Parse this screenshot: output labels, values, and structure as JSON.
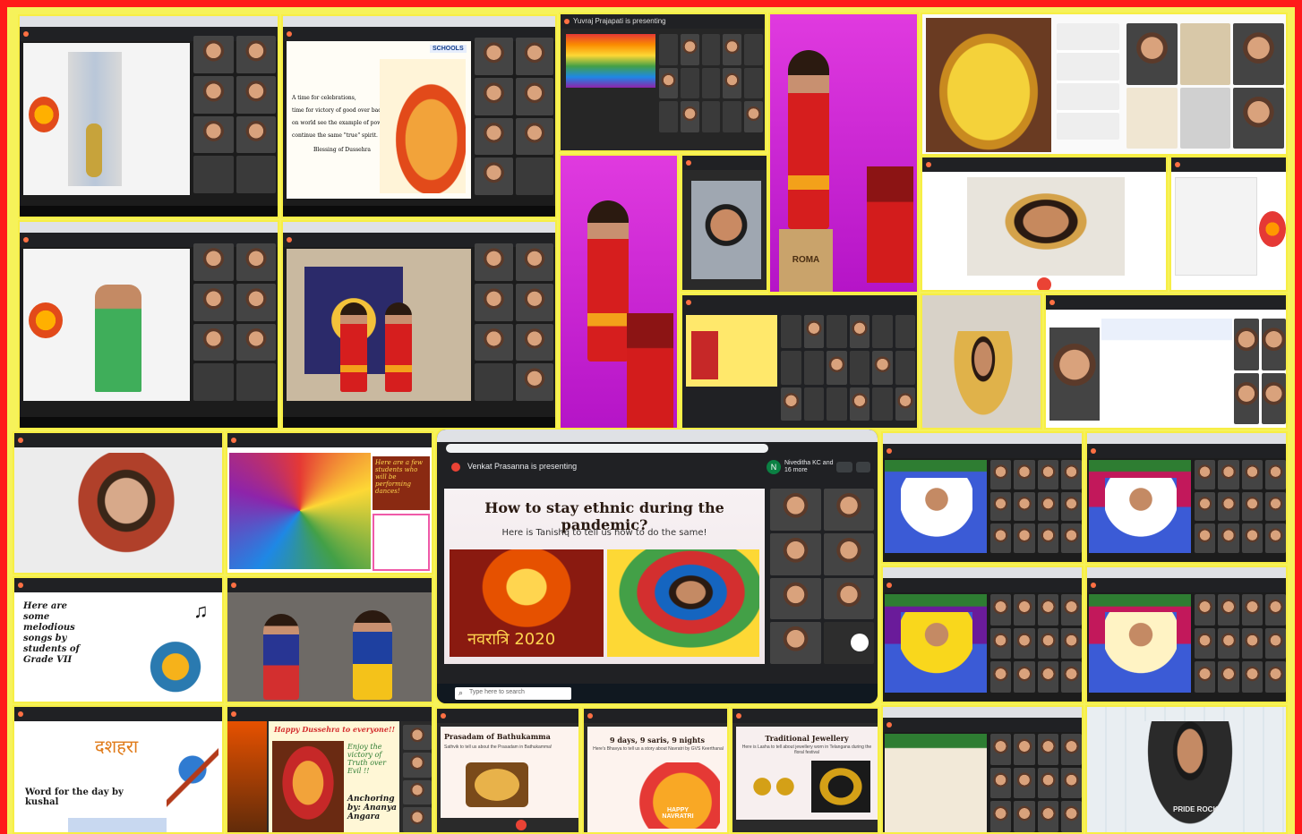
{
  "tiles": {
    "dussehra_card": {
      "lines": [
        "A time for celebrations,",
        "time for victory of good over bad,",
        "on world see the example of power of god",
        "continue the same \"true\" spirit.",
        "Blessing of Dussehra"
      ],
      "brand": "SCHOOLS"
    },
    "zoom_banner": {
      "text": "Yuvraj Prajapati is presenting"
    },
    "bathukamma_box": {
      "text": "ROMA"
    },
    "pandemic": {
      "presenter": "Venkat Prasanna is presenting",
      "participants": "Niveditha KC and 16 more",
      "avatar_letter": "N",
      "title": "How to stay ethnic during the pandemic?",
      "subtitle": "Here is Tanishq to tell us how to do the same!",
      "navratri_label": "नवरात्रि 2020",
      "search_placeholder": "Type here to search"
    },
    "dancers_note": {
      "text": "Here are a few students who will be performing dances!"
    },
    "songs": {
      "text": "Here are some melodious songs by students of Grade VII"
    },
    "word_of_day": {
      "title": "दशहरा",
      "caption": "Word for the day by kushal"
    },
    "happy_dussehra": {
      "title": "Happy Dussehra to everyone!!",
      "enjoy": "Enjoy the victory of Truth over Evil !!",
      "anchoring": "Anchoring by: Ananya Angara"
    },
    "prasadam": {
      "title": "Prasadam of Bathukamma",
      "subtitle": "Sathvik to tell us about the Prasadam in Bathukamma!"
    },
    "saris": {
      "title": "9 days, 9 saris, 9 nights",
      "subtitle": "Here's Bhavya to tell us a story about Navratri by GVS Keerthanal",
      "banner": "HAPPY NAVRATRI"
    },
    "jewellery": {
      "title": "Traditional Jewellery",
      "subtitle": "Here is Lasha to tell about jewellery worn in Telangana during the floral festival"
    },
    "kid_shirt": {
      "text": "PRIDE ROCK"
    }
  },
  "colors": {
    "frame": "#ff1a1a",
    "border": "#f7ee45",
    "meet_dark": "#202124",
    "record": "#ea4335"
  }
}
